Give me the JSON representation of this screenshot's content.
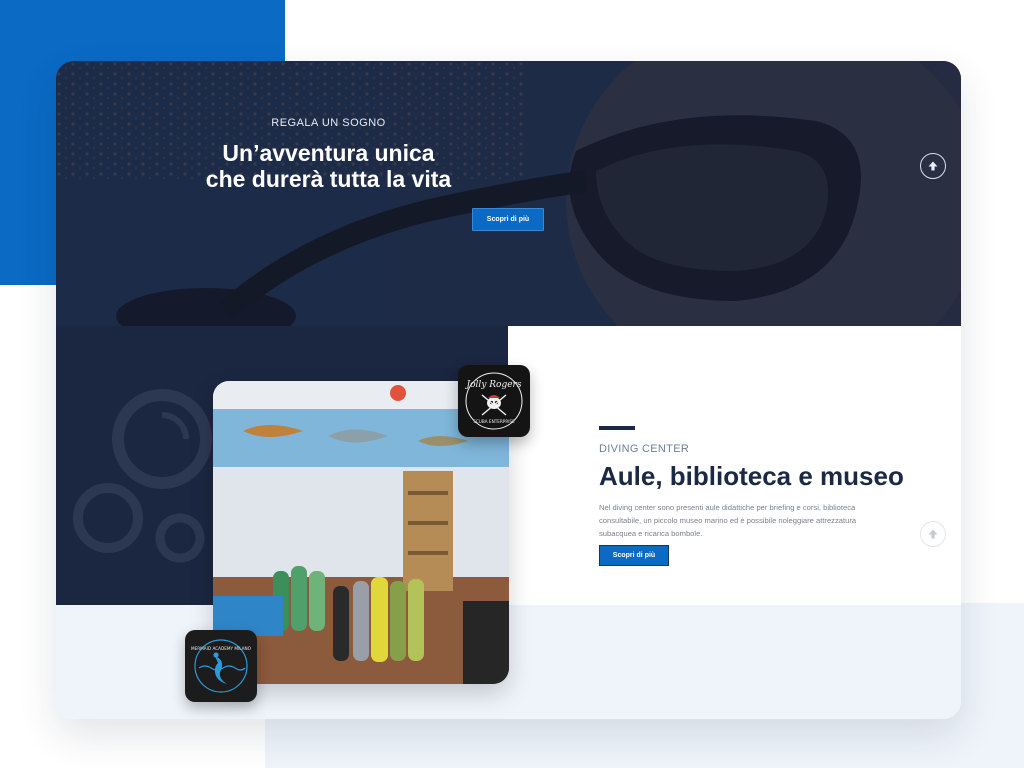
{
  "hero": {
    "eyebrow": "REGALA UN SOGNO",
    "title_line1": "Un’avventura unica",
    "title_line2": "che durerà tutta la vita",
    "button_label": "Scopri di più"
  },
  "section": {
    "eyebrow": "DIVING CENTER",
    "title": "Aule, biblioteca e museo",
    "description": "Nel diving center sono presenti aule didattiche per briefing e corsi, biblioteca consultabile, un piccolo museo marino ed è possibile noleggiare attrezzatura subacquea e ricarica bombole.",
    "button_label": "Scopri di più"
  },
  "logos": {
    "jolly_rogers": "Jolly Rogers",
    "jolly_rogers_sub": "SCUBA ENTERPRISE",
    "mermaid": "MERMAID ACADEMY MILANO"
  },
  "icons": {
    "scroll_up": "arrow-up-icon",
    "jolly_logo": "skull-crossed-swords-logo",
    "mermaid_logo": "mermaid-logo"
  },
  "colors": {
    "brand_blue": "#0a6ac4",
    "navy": "#1b2944",
    "dark_panel": "#1b2640",
    "pale_bg": "#eff4fb"
  }
}
